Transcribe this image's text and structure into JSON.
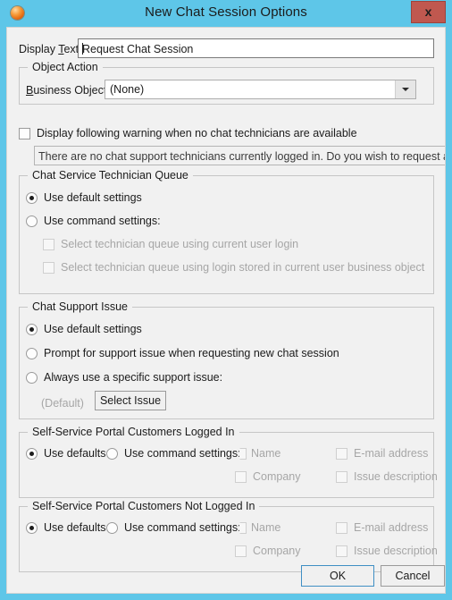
{
  "window": {
    "title": "New Chat Session Options",
    "app_icon": "orange-sphere-icon",
    "close_label": "x",
    "border_color": "#5ec6e8",
    "client_bg": "#f1f1f1"
  },
  "display_text": {
    "label_prefix": "Display ",
    "label_accel": "T",
    "label_suffix": "ext:",
    "value": "Request Chat Session"
  },
  "object_action": {
    "legend": "Object Action",
    "business_object": {
      "label_accel": "B",
      "label_prefix": "",
      "label_suffix": "usiness Object:",
      "value": "(None)"
    }
  },
  "warning": {
    "checkbox_label": "Display following warning when no chat technicians are available",
    "checked": false,
    "message": "There are no chat support technicians currently logged in.  Do you wish to request a chat session anyway?"
  },
  "technician_queue": {
    "legend": "Chat Service Technician Queue",
    "options": [
      {
        "label": "Use default settings",
        "checked": true
      },
      {
        "label": "Use command settings:",
        "checked": false
      }
    ],
    "sub_checkboxes": [
      {
        "label": "Select technician queue using current user login",
        "checked": false,
        "disabled": true
      },
      {
        "label": "Select technician queue using login stored in current user business object",
        "checked": false,
        "disabled": true
      }
    ]
  },
  "support_issue": {
    "legend": "Chat Support Issue",
    "options": [
      {
        "label": "Use default settings",
        "checked": true
      },
      {
        "label": "Prompt for support issue when requesting new chat session",
        "checked": false
      },
      {
        "label": "Always use a specific support issue:",
        "checked": false
      }
    ],
    "current_issue": "(Default)",
    "select_button": "Select Issue"
  },
  "portal_logged_in": {
    "legend": "Self-Service Portal Customers Logged In",
    "use_defaults": {
      "label": "Use defaults",
      "checked": true
    },
    "use_command": {
      "label": "Use command settings:",
      "checked": false
    },
    "fields": [
      {
        "label": "Name",
        "checked": false,
        "disabled": true
      },
      {
        "label": "E-mail address",
        "checked": false,
        "disabled": true
      },
      {
        "label": "Company",
        "checked": false,
        "disabled": true
      },
      {
        "label": "Issue description",
        "checked": false,
        "disabled": true
      }
    ]
  },
  "portal_not_logged_in": {
    "legend": "Self-Service Portal Customers Not Logged In",
    "use_defaults": {
      "label": "Use defaults",
      "checked": true
    },
    "use_command": {
      "label": "Use command settings:",
      "checked": false
    },
    "fields": [
      {
        "label": "Name",
        "checked": false,
        "disabled": true
      },
      {
        "label": "E-mail address",
        "checked": false,
        "disabled": true
      },
      {
        "label": "Company",
        "checked": false,
        "disabled": true
      },
      {
        "label": "Issue description",
        "checked": false,
        "disabled": true
      }
    ]
  },
  "footer": {
    "ok_label": "OK",
    "cancel_label": "Cancel"
  }
}
